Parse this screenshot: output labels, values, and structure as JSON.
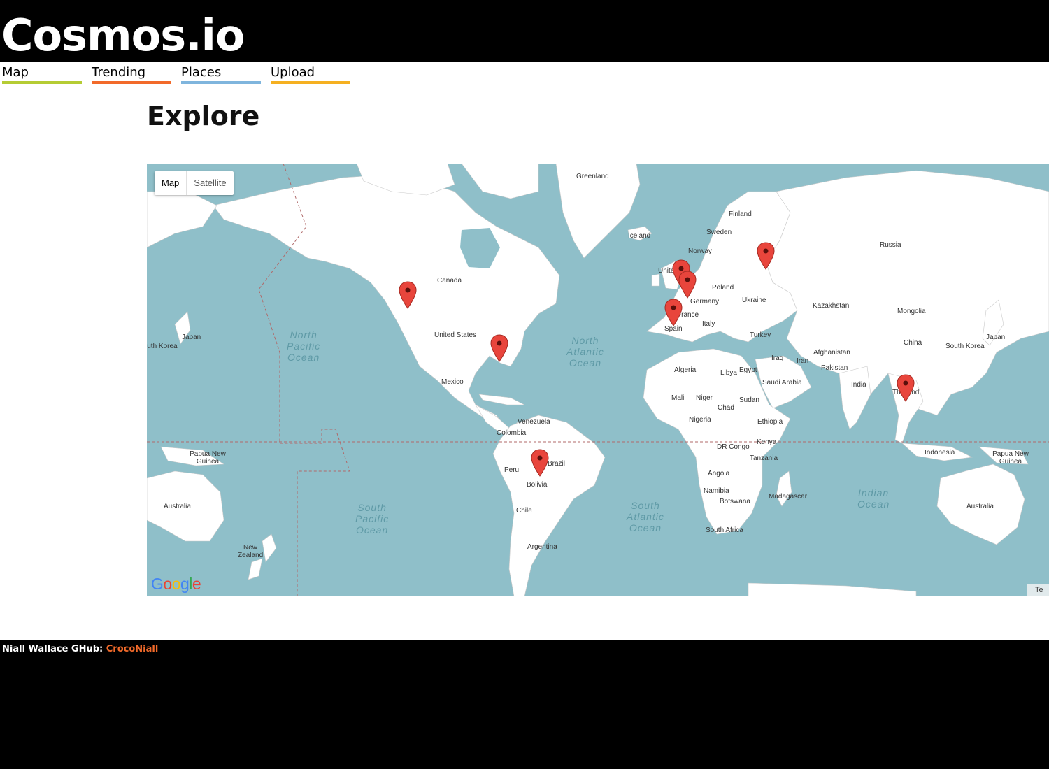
{
  "header": {
    "logo": "Cosmos.io"
  },
  "nav": {
    "items": [
      {
        "label": "Map",
        "color": "#b5cc34"
      },
      {
        "label": "Trending",
        "color": "#f26a2a"
      },
      {
        "label": "Places",
        "color": "#7fb5dd"
      },
      {
        "label": "Upload",
        "color": "#f5b021"
      }
    ]
  },
  "main": {
    "title": "Explore"
  },
  "map": {
    "type_control": {
      "map_label": "Map",
      "satellite_label": "Satellite",
      "active": "Map"
    },
    "attribution": "Google",
    "terms_label": "Te",
    "colors": {
      "water": "#8fbfc9",
      "land": "#ffffff",
      "marker": "#e8453c"
    },
    "country_labels": [
      "Greenland",
      "Finland",
      "Sweden",
      "Iceland",
      "Norway",
      "Russia",
      "United Kingdom",
      "Poland",
      "Germany",
      "Ukraine",
      "Canada",
      "Kazakhstan",
      "Mongolia",
      "France",
      "Italy",
      "Spain",
      "Japan",
      "South Korea",
      "United States",
      "Turkey",
      "China",
      "Afghanistan",
      "Iraq",
      "Iran",
      "Pakistan",
      "Algeria",
      "Libya",
      "Egypt",
      "Saudi Arabia",
      "India",
      "Mexico",
      "Thailand",
      "Mali",
      "Niger",
      "Chad",
      "Sudan",
      "Nigeria",
      "Ethiopia",
      "Venezuela",
      "Colombia",
      "DR Congo",
      "Kenya",
      "Indonesia",
      "Papua New Guinea",
      "Brazil",
      "Tanzania",
      "Peru",
      "Bolivia",
      "Angola",
      "Namibia",
      "Botswana",
      "Madagascar",
      "Australia",
      "Chile",
      "South Africa",
      "Argentina",
      "New Zealand"
    ],
    "oceans": [
      "North\nPacific\nOcean",
      "North\nAtlantic\nOcean",
      "South\nPacific\nOcean",
      "South\nAtlantic\nOcean",
      "Indian\nOcean"
    ],
    "markers": [
      "Vancouver",
      "Atlanta",
      "Moscow",
      "London",
      "Amsterdam",
      "Madrid",
      "Thailand",
      "Bolivia"
    ]
  },
  "footer": {
    "credit_text": "Niall Wallace GHub: ",
    "github_link": "CrocoNiall"
  }
}
